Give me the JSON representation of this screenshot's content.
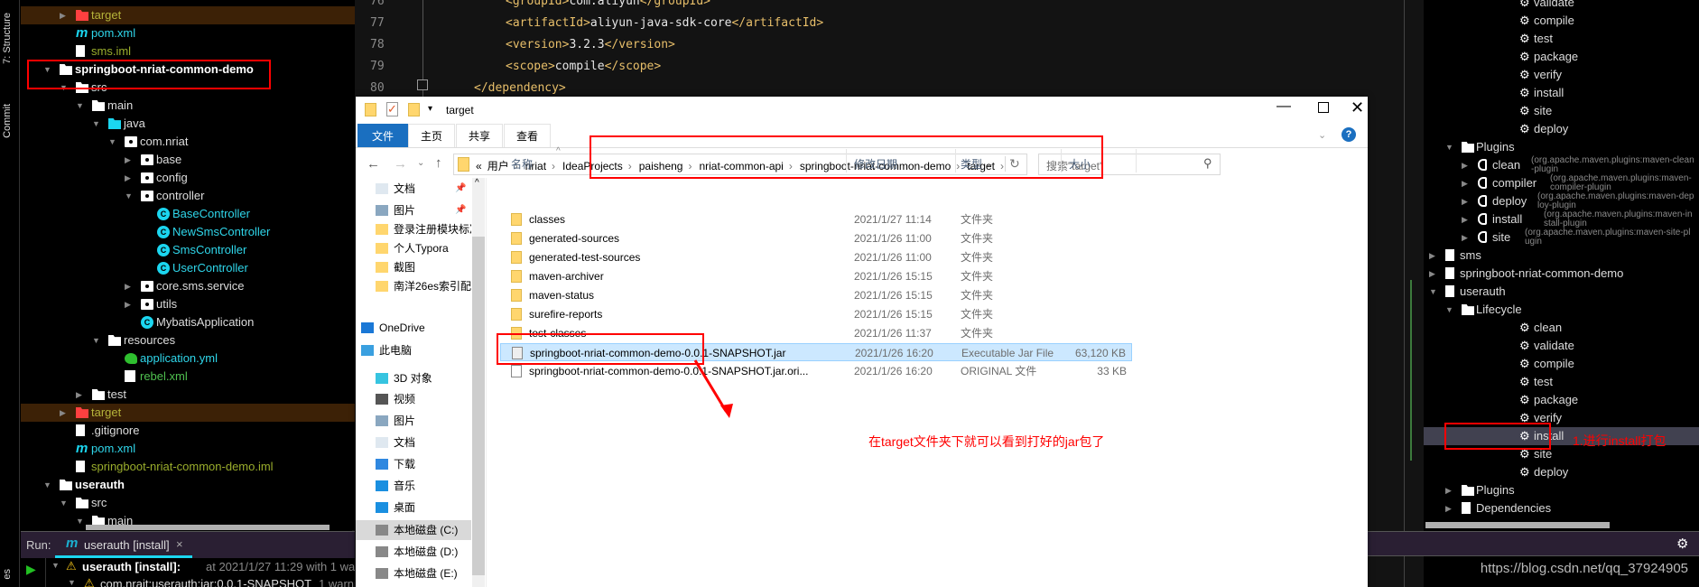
{
  "sidebar_left": {
    "structure_label": "7: Structure",
    "commit_label": "Commit",
    "bottom_label": "es"
  },
  "project_tree": [
    {
      "label": "target",
      "level": 1,
      "arrow": "right",
      "icon": "folder-red",
      "color": "#b5b33a",
      "hl": true
    },
    {
      "label": "pom.xml",
      "level": 1,
      "arrow": "",
      "icon": "maven",
      "color": "#2fd6ea"
    },
    {
      "label": "sms.iml",
      "level": 1,
      "arrow": "",
      "icon": "file",
      "color": "#9aad2c"
    },
    {
      "label": "springboot-nriat-common-demo",
      "level": 0,
      "arrow": "down",
      "icon": "module",
      "color": "#ffffff",
      "bold": true
    },
    {
      "label": "src",
      "level": 1,
      "arrow": "down",
      "icon": "folder",
      "color": "#dddddd"
    },
    {
      "label": "main",
      "level": 2,
      "arrow": "down",
      "icon": "folder",
      "color": "#dddddd"
    },
    {
      "label": "java",
      "level": 3,
      "arrow": "down",
      "icon": "folder-cyan",
      "color": "#dddddd"
    },
    {
      "label": "com.nriat",
      "level": 4,
      "arrow": "down",
      "icon": "pkg",
      "color": "#dddddd"
    },
    {
      "label": "base",
      "level": 5,
      "arrow": "right",
      "icon": "pkg",
      "color": "#dddddd"
    },
    {
      "label": "config",
      "level": 5,
      "arrow": "right",
      "icon": "pkg",
      "color": "#dddddd"
    },
    {
      "label": "controller",
      "level": 5,
      "arrow": "down",
      "icon": "pkg",
      "color": "#dddddd"
    },
    {
      "label": "BaseController",
      "level": 6,
      "arrow": "",
      "icon": "cls",
      "color": "#2fd6ea"
    },
    {
      "label": "NewSmsController",
      "level": 6,
      "arrow": "",
      "icon": "cls",
      "color": "#2fd6ea"
    },
    {
      "label": "SmsController",
      "level": 6,
      "arrow": "",
      "icon": "cls",
      "color": "#2fd6ea"
    },
    {
      "label": "UserController",
      "level": 6,
      "arrow": "",
      "icon": "cls",
      "color": "#2fd6ea"
    },
    {
      "label": "core.sms.service",
      "level": 5,
      "arrow": "right",
      "icon": "pkg",
      "color": "#dddddd"
    },
    {
      "label": "utils",
      "level": 5,
      "arrow": "right",
      "icon": "pkg",
      "color": "#dddddd"
    },
    {
      "label": "MybatisApplication",
      "level": 5,
      "arrow": "",
      "icon": "cls",
      "color": "#dddddd"
    },
    {
      "label": "resources",
      "level": 3,
      "arrow": "down",
      "icon": "folder",
      "color": "#dddddd"
    },
    {
      "label": "application.yml",
      "level": 4,
      "arrow": "",
      "icon": "yml",
      "color": "#2fd6ea"
    },
    {
      "label": "rebel.xml",
      "level": 4,
      "arrow": "",
      "icon": "xml",
      "color": "#4fc04f"
    },
    {
      "label": "test",
      "level": 2,
      "arrow": "right",
      "icon": "folder",
      "color": "#dddddd"
    },
    {
      "label": "target",
      "level": 1,
      "arrow": "right",
      "icon": "folder-red",
      "color": "#b5b33a",
      "hl": true
    },
    {
      "label": ".gitignore",
      "level": 1,
      "arrow": "",
      "icon": "file",
      "color": "#dddddd"
    },
    {
      "label": "pom.xml",
      "level": 1,
      "arrow": "",
      "icon": "maven",
      "color": "#2fd6ea"
    },
    {
      "label": "springboot-nriat-common-demo.iml",
      "level": 1,
      "arrow": "",
      "icon": "file",
      "color": "#9aad2c"
    },
    {
      "label": "userauth",
      "level": 0,
      "arrow": "down",
      "icon": "module",
      "color": "#ffffff",
      "bold": true
    },
    {
      "label": "src",
      "level": 1,
      "arrow": "down",
      "icon": "folder",
      "color": "#dddddd"
    },
    {
      "label": "main",
      "level": 2,
      "arrow": "down",
      "icon": "folder",
      "color": "#dddddd"
    }
  ],
  "run_panel": {
    "label": "Run:",
    "tab_label": "userauth [install]",
    "close": "×",
    "line1_title": "userauth [install]:",
    "line1_detail": "at 2021/1/27 11:29 with 1 warning",
    "line2_title": "com.nrait:userauth:jar:0.0.1-SNAPSHOT",
    "line2_detail": "1 warning"
  },
  "editor": {
    "lines": [
      {
        "num": "76",
        "indent": "        ",
        "open": "<groupId>",
        "text": "com.aliyun",
        "close": "</groupId>"
      },
      {
        "num": "77",
        "indent": "        ",
        "open": "<artifactId>",
        "text": "aliyun-java-sdk-core",
        "close": "</artifactId>"
      },
      {
        "num": "78",
        "indent": "        ",
        "open": "<version>",
        "text": "3.2.3",
        "close": "</version>"
      },
      {
        "num": "79",
        "indent": "        ",
        "open": "<scope>",
        "text": "compile",
        "close": "</scope>"
      },
      {
        "num": "80",
        "indent": "    ",
        "open": "</dependency>",
        "text": "",
        "close": ""
      }
    ]
  },
  "explorer": {
    "title": "target",
    "ribbon_tabs": [
      "文件",
      "主页",
      "共享",
      "查看"
    ],
    "address_segments": [
      "«",
      "用户",
      "nriat",
      "IdeaProjects",
      "paisheng",
      "nriat-common-api",
      "springboot-nriat-common-demo",
      "target"
    ],
    "search_placeholder": "搜索\"target\"",
    "columns": {
      "name": "名称",
      "date": "修改日期",
      "type": "类型",
      "size": "大小"
    },
    "nav_items": [
      {
        "label": "文档",
        "icon": "documents-icon",
        "pinned": true
      },
      {
        "label": "图片",
        "icon": "pictures-icon",
        "pinned": true
      },
      {
        "label": "登录注册模块标准",
        "icon": "folder-icon"
      },
      {
        "label": "个人Typora",
        "icon": "folder-icon"
      },
      {
        "label": "截图",
        "icon": "folder-icon"
      },
      {
        "label": "南洋26es索引配置",
        "icon": "folder-icon"
      },
      {
        "label": "OneDrive",
        "icon": "onedrive-icon"
      },
      {
        "label": "此电脑",
        "icon": "computer-icon"
      },
      {
        "label": "3D 对象",
        "icon": "3d-objects-icon"
      },
      {
        "label": "视频",
        "icon": "videos-icon"
      },
      {
        "label": "图片",
        "icon": "pictures-icon"
      },
      {
        "label": "文档",
        "icon": "documents-icon"
      },
      {
        "label": "下载",
        "icon": "downloads-icon"
      },
      {
        "label": "音乐",
        "icon": "music-icon"
      },
      {
        "label": "桌面",
        "icon": "desktop-icon"
      },
      {
        "label": "本地磁盘 (C:)",
        "icon": "drive-icon",
        "selected": true
      },
      {
        "label": "本地磁盘 (D:)",
        "icon": "drive-icon"
      },
      {
        "label": "本地磁盘 (E:)",
        "icon": "drive-icon"
      }
    ],
    "files": [
      {
        "name": "classes",
        "date": "2021/1/27 11:14",
        "type": "文件夹",
        "size": "",
        "kind": "folder"
      },
      {
        "name": "generated-sources",
        "date": "2021/1/26 11:00",
        "type": "文件夹",
        "size": "",
        "kind": "folder"
      },
      {
        "name": "generated-test-sources",
        "date": "2021/1/26 11:00",
        "type": "文件夹",
        "size": "",
        "kind": "folder"
      },
      {
        "name": "maven-archiver",
        "date": "2021/1/26 15:15",
        "type": "文件夹",
        "size": "",
        "kind": "folder"
      },
      {
        "name": "maven-status",
        "date": "2021/1/26 15:15",
        "type": "文件夹",
        "size": "",
        "kind": "folder"
      },
      {
        "name": "surefire-reports",
        "date": "2021/1/26 15:15",
        "type": "文件夹",
        "size": "",
        "kind": "folder"
      },
      {
        "name": "test-classes",
        "date": "2021/1/26 11:37",
        "type": "文件夹",
        "size": "",
        "kind": "folder"
      },
      {
        "name": "springboot-nriat-common-demo-0.0.1-SNAPSHOT.jar",
        "date": "2021/1/26 16:20",
        "type": "Executable Jar File",
        "size": "63,120 KB",
        "kind": "jar",
        "selected": true
      },
      {
        "name": "springboot-nriat-common-demo-0.0.1-SNAPSHOT.jar.ori...",
        "date": "2021/1/26 16:20",
        "type": "ORIGINAL 文件",
        "size": "33 KB",
        "kind": "doc"
      }
    ],
    "annotation": "在target文件夹下就可以看到打好的jar包了"
  },
  "maven_tree": [
    {
      "label": "validate",
      "level": 2,
      "kind": "goal"
    },
    {
      "label": "compile",
      "level": 2,
      "kind": "goal"
    },
    {
      "label": "test",
      "level": 2,
      "kind": "goal"
    },
    {
      "label": "package",
      "level": 2,
      "kind": "goal"
    },
    {
      "label": "verify",
      "level": 2,
      "kind": "goal"
    },
    {
      "label": "install",
      "level": 2,
      "kind": "goal"
    },
    {
      "label": "site",
      "level": 2,
      "kind": "goal"
    },
    {
      "label": "deploy",
      "level": 2,
      "kind": "goal"
    },
    {
      "label": "Plugins",
      "level": 1,
      "kind": "group",
      "arrow": "down"
    },
    {
      "label": "clean",
      "detail": "(org.apache.maven.plugins:maven-clean-plugin",
      "level": 2,
      "kind": "plugin",
      "arrow": "right"
    },
    {
      "label": "compiler",
      "detail": "(org.apache.maven.plugins:maven-compiler-plugin",
      "level": 2,
      "kind": "plugin",
      "arrow": "right"
    },
    {
      "label": "deploy",
      "detail": "(org.apache.maven.plugins:maven-deploy-plugin",
      "level": 2,
      "kind": "plugin",
      "arrow": "right"
    },
    {
      "label": "install",
      "detail": "(org.apache.maven.plugins:maven-install-plugin",
      "level": 2,
      "kind": "plugin",
      "arrow": "right"
    },
    {
      "label": "site",
      "detail": "(org.apache.maven.plugins:maven-site-plugin",
      "level": 2,
      "kind": "plugin",
      "arrow": "right"
    },
    {
      "label": "sms",
      "level": 0,
      "kind": "project",
      "arrow": "right"
    },
    {
      "label": "springboot-nriat-common-demo",
      "level": 0,
      "kind": "project",
      "arrow": "right"
    },
    {
      "label": "userauth",
      "level": 0,
      "kind": "project",
      "arrow": "down"
    },
    {
      "label": "Lifecycle",
      "level": 1,
      "kind": "group",
      "arrow": "down"
    },
    {
      "label": "clean",
      "level": 2,
      "kind": "goal"
    },
    {
      "label": "validate",
      "level": 2,
      "kind": "goal"
    },
    {
      "label": "compile",
      "level": 2,
      "kind": "goal"
    },
    {
      "label": "test",
      "level": 2,
      "kind": "goal"
    },
    {
      "label": "package",
      "level": 2,
      "kind": "goal"
    },
    {
      "label": "verify",
      "level": 2,
      "kind": "goal"
    },
    {
      "label": "install",
      "level": 2,
      "kind": "goal",
      "hl": true
    },
    {
      "label": "site",
      "level": 2,
      "kind": "goal"
    },
    {
      "label": "deploy",
      "level": 2,
      "kind": "goal"
    },
    {
      "label": "Plugins",
      "level": 1,
      "kind": "group",
      "arrow": "right"
    },
    {
      "label": "Dependencies",
      "level": 1,
      "kind": "deps",
      "arrow": "right"
    }
  ],
  "maven_annotation": "1.进行install打包",
  "watermark": "https://blog.csdn.net/qq_37924905",
  "colors": {
    "annotation_red": "#ff0000",
    "ide_bg": "#000000",
    "run_tab_accent": "#1bd6f0",
    "selection_blue": "#cce8ff"
  }
}
